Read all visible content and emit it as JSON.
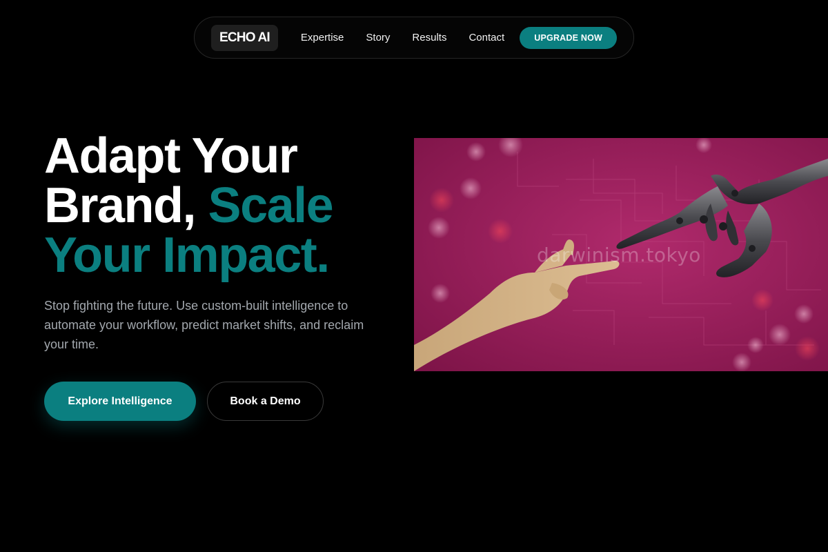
{
  "nav": {
    "logo": "ECHO AI",
    "links": [
      "Expertise",
      "Story",
      "Results",
      "Contact"
    ],
    "cta": "UPGRADE NOW"
  },
  "hero": {
    "title_line1": "Adapt Your",
    "title_line2_white": "Brand,",
    "title_line2_accent": "Scale",
    "title_line3_accent": "Your Impact.",
    "subtitle": "Stop fighting the future. Use custom-built intelligence to automate your workflow, predict market shifts, and reclaim your time.",
    "primary_button": "Explore Intelligence",
    "secondary_button": "Book a Demo",
    "image_watermark": "darwinism.tokyo"
  },
  "colors": {
    "accent": "#0b7f80",
    "background": "#000000",
    "image_background": "#9c1f5a"
  }
}
